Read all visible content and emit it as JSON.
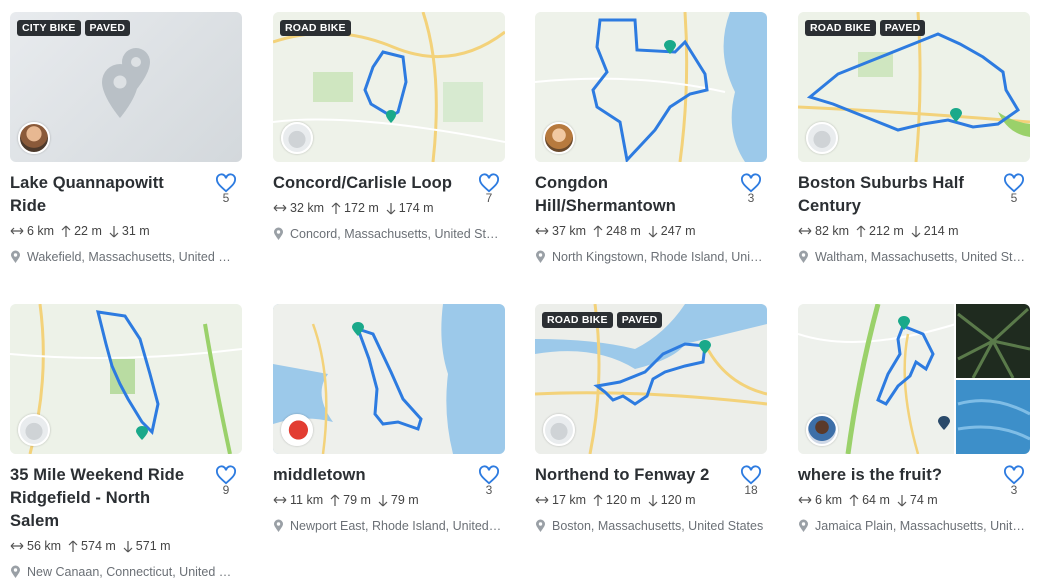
{
  "routes": [
    {
      "title": "Lake Quannapowitt Ride",
      "tags": [
        "CITY BIKE",
        "PAVED"
      ],
      "likes": "5",
      "distance": "6 km",
      "ascent": "22 m",
      "descent": "31 m",
      "location": "Wakefield, Massachusetts, United States"
    },
    {
      "title": "Concord/Carlisle Loop",
      "tags": [
        "ROAD BIKE"
      ],
      "likes": "7",
      "distance": "32 km",
      "ascent": "172 m",
      "descent": "174 m",
      "location": "Concord, Massachusetts, United States"
    },
    {
      "title": "Congdon Hill/Shermantown",
      "tags": [],
      "likes": "3",
      "distance": "37 km",
      "ascent": "248 m",
      "descent": "247 m",
      "location": "North Kingstown, Rhode Island, United States"
    },
    {
      "title": "Boston Suburbs Half Century",
      "tags": [
        "ROAD BIKE",
        "PAVED"
      ],
      "likes": "5",
      "distance": "82 km",
      "ascent": "212 m",
      "descent": "214 m",
      "location": "Waltham, Massachusetts, United States"
    },
    {
      "title": "35 Mile Weekend Ride Ridgefield - North Salem",
      "tags": [],
      "likes": "9",
      "distance": "56 km",
      "ascent": "574 m",
      "descent": "571 m",
      "location": "New Canaan, Connecticut, United States"
    },
    {
      "title": "middletown",
      "tags": [],
      "likes": "3",
      "distance": "11 km",
      "ascent": "79 m",
      "descent": "79 m",
      "location": "Newport East, Rhode Island, United States"
    },
    {
      "title": "Northend to Fenway 2",
      "tags": [
        "ROAD BIKE",
        "PAVED"
      ],
      "likes": "18",
      "distance": "17 km",
      "ascent": "120 m",
      "descent": "120 m",
      "location": "Boston, Massachusetts, United States"
    },
    {
      "title": "where is the fruit?",
      "tags": [],
      "likes": "3",
      "distance": "6 km",
      "ascent": "64 m",
      "descent": "74 m",
      "location": "Jamaica Plain, Massachusetts, United States"
    }
  ],
  "colors": {
    "route": "#2d7be0",
    "heart": "#2d7be0",
    "tag_bg": "#2b2f33",
    "pin": "#1aa98a"
  },
  "icons": {
    "like": "heart-icon",
    "distance": "arrows-horizontal-icon",
    "ascent": "arrow-up-icon",
    "descent": "arrow-down-icon",
    "location": "map-pin-icon",
    "placeholder": "map-pins-placeholder-icon",
    "creator": "avatar"
  }
}
